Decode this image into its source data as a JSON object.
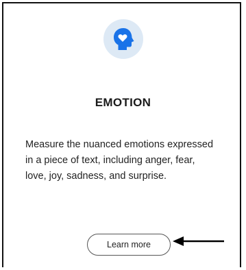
{
  "card": {
    "icon": "head-heart-icon",
    "title": "EMOTION",
    "description": "Measure the nuanced emotions expressed in a piece of text, including anger, fear, love, joy, sadness, and surprise.",
    "learn_more_label": "Learn more"
  },
  "annotation": {
    "icon": "left-arrow-icon"
  },
  "colors": {
    "accent": "#1a73e8",
    "icon_bg": "#dde9f5",
    "text": "#1b1b1b"
  }
}
